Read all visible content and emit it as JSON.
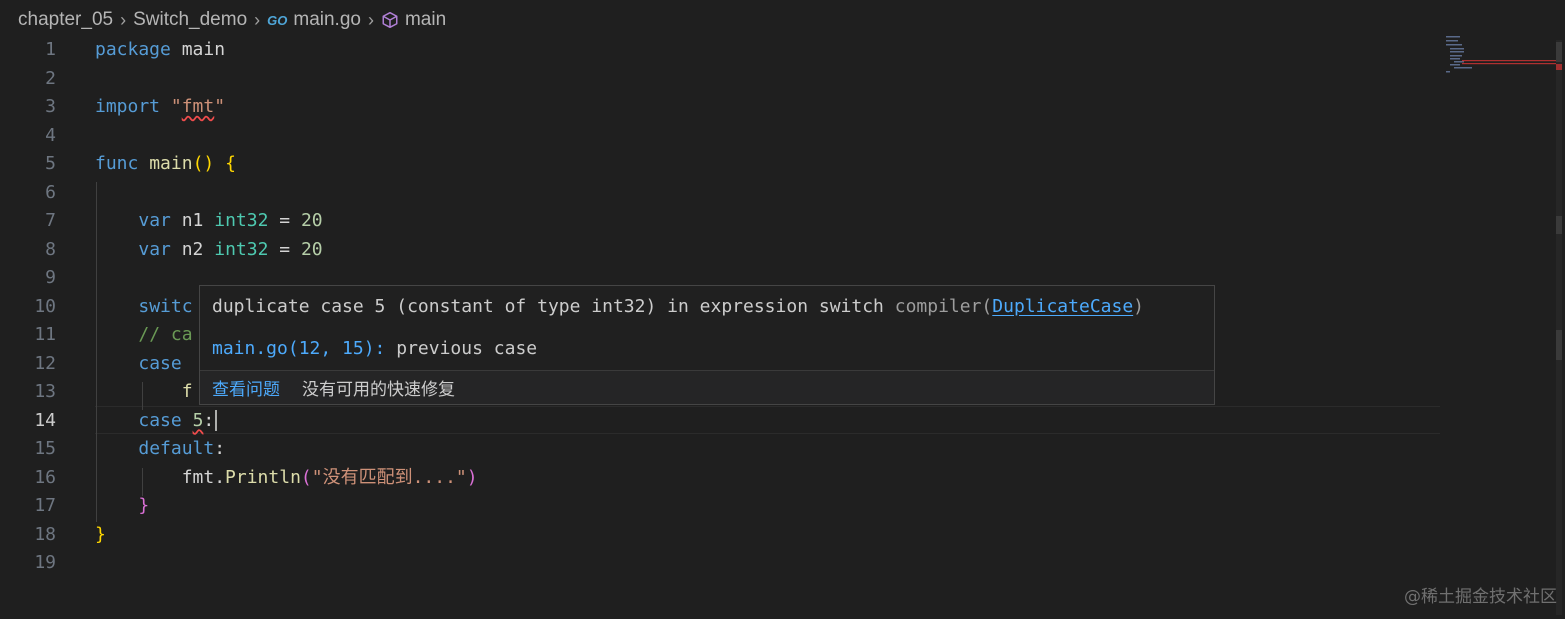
{
  "breadcrumb": {
    "items": [
      "chapter_05",
      "Switch_demo",
      "main.go",
      "main"
    ],
    "go_badge": "GO"
  },
  "editor": {
    "active_line": 14,
    "line_numbers": [
      "1",
      "2",
      "3",
      "4",
      "5",
      "6",
      "7",
      "8",
      "9",
      "10",
      "11",
      "12",
      "13",
      "14",
      "15",
      "16",
      "17",
      "18",
      "19"
    ],
    "lines": [
      [
        [
          "kw",
          "package"
        ],
        [
          "pl",
          " main"
        ]
      ],
      [],
      [
        [
          "kw",
          "import"
        ],
        [
          "pl",
          " "
        ],
        [
          "str",
          "\""
        ],
        [
          "str err",
          "fmt"
        ],
        [
          "str",
          "\""
        ]
      ],
      [],
      [
        [
          "kw",
          "func"
        ],
        [
          "pl",
          " "
        ],
        [
          "fn",
          "main"
        ],
        [
          "br1",
          "()"
        ],
        [
          "pl",
          " "
        ],
        [
          "br1",
          "{"
        ]
      ],
      [],
      [
        [
          "pl",
          "    "
        ],
        [
          "kw",
          "var"
        ],
        [
          "pl",
          " n1 "
        ],
        [
          "ty",
          "int32"
        ],
        [
          "pl",
          " = "
        ],
        [
          "num",
          "20"
        ]
      ],
      [
        [
          "pl",
          "    "
        ],
        [
          "kw",
          "var"
        ],
        [
          "pl",
          " n2 "
        ],
        [
          "ty",
          "int32"
        ],
        [
          "pl",
          " = "
        ],
        [
          "num",
          "20"
        ]
      ],
      [],
      [
        [
          "pl",
          "    "
        ],
        [
          "kw",
          "switc"
        ]
      ],
      [
        [
          "pl",
          "    "
        ],
        [
          "cm",
          "// ca"
        ]
      ],
      [
        [
          "pl",
          "    "
        ],
        [
          "kw",
          "case"
        ]
      ],
      [
        [
          "pl",
          "        "
        ],
        [
          "fn",
          "f"
        ]
      ],
      [
        [
          "pl",
          "    "
        ],
        [
          "kw",
          "case"
        ],
        [
          "pl",
          " "
        ],
        [
          "num err",
          "5"
        ],
        [
          "pl",
          ":"
        ],
        [
          "cursor",
          ""
        ]
      ],
      [
        [
          "pl",
          "    "
        ],
        [
          "kw",
          "default"
        ],
        [
          "pl",
          ":"
        ]
      ],
      [
        [
          "pl",
          "        fmt."
        ],
        [
          "fn",
          "Println"
        ],
        [
          "br2",
          "("
        ],
        [
          "str",
          "\"没有匹配到....\""
        ],
        [
          "br2",
          ")"
        ]
      ],
      [
        [
          "pl",
          "    "
        ],
        [
          "br2",
          "}"
        ]
      ],
      [
        [
          "br1",
          "}"
        ]
      ],
      []
    ]
  },
  "hover": {
    "message": "duplicate case 5 (constant of type int32) in expression switch",
    "source": "compiler(",
    "code": "DuplicateCase",
    "source_end": ")",
    "related_location": "main.go(12, 15):",
    "related_message": "previous case",
    "view_problem": "查看问题",
    "no_quick_fix": "没有可用的快速修复"
  },
  "watermark": "@稀土掘金技术社区",
  "colors": {
    "background": "#1f1f1f",
    "keyword": "#569cd6",
    "function": "#dcdcaa",
    "type": "#4ec9b0",
    "number": "#b5cea8",
    "string": "#ce9178",
    "comment": "#6a9955",
    "error": "#f14c4c",
    "link": "#4daafc"
  }
}
